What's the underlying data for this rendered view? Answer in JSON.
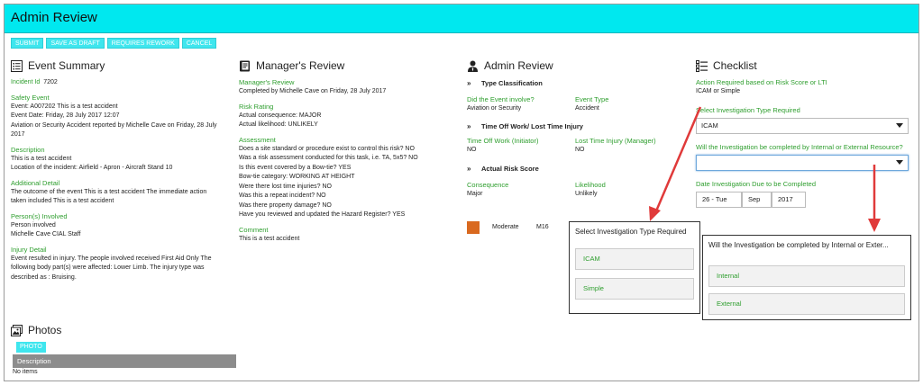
{
  "title": "Admin Review",
  "toolbar": {
    "submit": "SUBMIT",
    "save_draft": "SAVE AS DRAFT",
    "requires_rework": "REQUIRES REWORK",
    "cancel": "CANCEL"
  },
  "event_summary": {
    "heading": "Event Summary",
    "incident_id_label": "Incident Id",
    "incident_id": "7202",
    "safety_event_label": "Safety Event",
    "safety_event_lines": [
      "Event: A007202 This is a test accident",
      "Event Date: Friday, 28 July 2017 12:07",
      "Aviation or Security Accident reported by Michelle Cave on Friday, 28 July",
      "2017"
    ],
    "description_label": "Description",
    "description_lines": [
      "This is a test accident",
      "Location of the incident: Airfield - Apron - Aircraft Stand 10"
    ],
    "additional_label": "Additional Detail",
    "additional_lines": [
      "The outcome of the event This is a test accident  The immediate action",
      "taken included This is a test accident"
    ],
    "persons_label": "Person(s) Involved",
    "persons_lines": [
      "Person involved",
      "Michelle Cave CIAL Staff"
    ],
    "injury_label": "Injury Detail",
    "injury_lines": [
      "Event resulted in injury.  The people involved received First Aid Only   The",
      "following body part(s) were affected: Lower Limb.  The injury type was",
      "described as : Bruising."
    ]
  },
  "photos": {
    "heading": "Photos",
    "button": "PHOTO",
    "col_description": "Description",
    "empty": "No items"
  },
  "managers_review": {
    "heading": "Manager's Review",
    "mr_label": "Manager's Review",
    "mr_value": "Completed by Michelle Cave on Friday, 28 July 2017",
    "risk_label": "Risk Rating",
    "risk_lines": [
      "Actual consequence:  MAJOR",
      "Actual likelihood:  UNLIKELY"
    ],
    "assessment_label": "Assessment",
    "assessment_lines": [
      "Does a site standard or procedure exist to control this risk?  NO",
      "Was a risk assessment conducted for this task, i.e. TA, 5x5?  NO",
      "Is this event covered by a Bow-tie?  YES",
      "Bow-tie category:  WORKING AT HEIGHT",
      "Were there lost time injuries?  NO",
      "Was this a repeat incident?  NO",
      "Was there property damage?  NO",
      "Have you reviewed and updated the Hazard Register?  YES"
    ],
    "comment_label": "Comment",
    "comment_value": "This is a test accident"
  },
  "admin_review": {
    "heading": "Admin Review",
    "type_class": "Type Classification",
    "did_involve_label": "Did the Event involve?",
    "did_involve_value": "Aviation or Security",
    "event_type_label": "Event Type",
    "event_type_value": "Accident",
    "time_off_head": "Time Off Work/ Lost Time Injury",
    "time_off_label": "Time Off Work (Initiator)",
    "time_off_value": "NO",
    "lti_label": "Lost Time Injury (Manager)",
    "lti_value": "NO",
    "risk_head": "Actual Risk Score",
    "consequence_label": "Consequence",
    "consequence_value": "Major",
    "likelihood_label": "Likelihood",
    "likelihood_value": "Unlikely",
    "score_rating": "Moderate",
    "score_code": "M16",
    "score_color": "#d9691f"
  },
  "checklist": {
    "heading": "Checklist",
    "action_label": "Action Required based on Risk Score or LTI",
    "action_value": "ICAM or Simple",
    "inv_type_label": "Select Investigation Type Required",
    "inv_type_value": "ICAM",
    "internal_label": "Will the Investigation be completed by Internal or External Resource?",
    "internal_value": "",
    "due_label": "Date Investigation Due to be Completed",
    "due_day": "26 - Tue",
    "due_month": "Sep",
    "due_year": "2017"
  },
  "popup_type": {
    "title": "Select Investigation Type Required",
    "options": [
      "ICAM",
      "Simple"
    ]
  },
  "popup_resource": {
    "title": "Will the Investigation be completed by Internal or Exter...",
    "options": [
      "Internal",
      "External"
    ]
  },
  "colors": {
    "title_bar": "#00e8ef",
    "button": "#3fe6ee",
    "label_green": "#2e9e2e",
    "arrow_red": "#e03a3a"
  }
}
